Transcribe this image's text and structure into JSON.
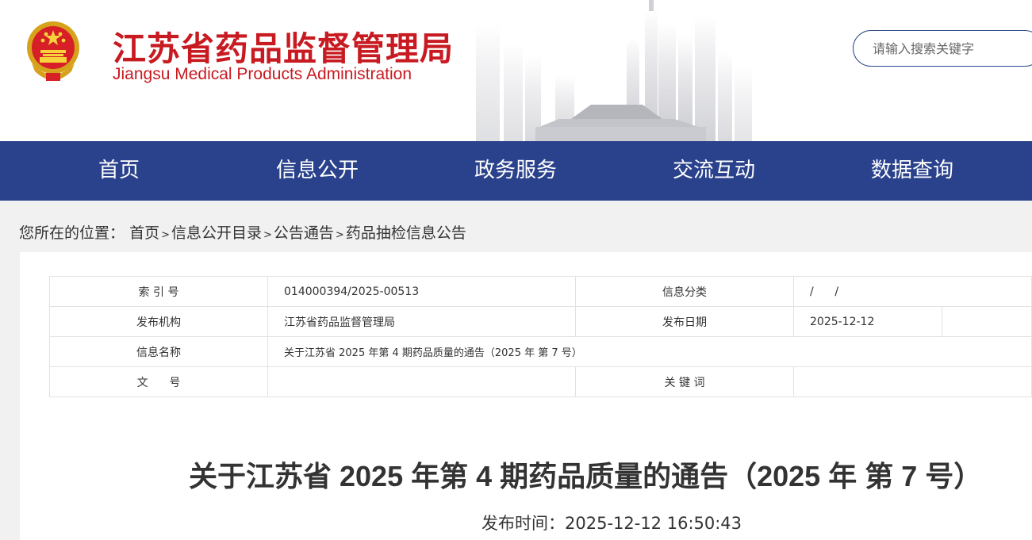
{
  "header": {
    "title_cn": "江苏省药品监督管理局",
    "title_en": "Jiangsu Medical Products Administration",
    "emblem_icon": "national-emblem-icon",
    "search_placeholder": "请输入搜索关键字"
  },
  "nav": {
    "items": [
      {
        "label": "首页"
      },
      {
        "label": "信息公开"
      },
      {
        "label": "政务服务"
      },
      {
        "label": "交流互动"
      },
      {
        "label": "数据查询"
      }
    ]
  },
  "breadcrumb": {
    "prefix": "您所在的位置：",
    "items": [
      {
        "label": "首页"
      },
      {
        "label": "信息公开目录"
      },
      {
        "label": "公告通告"
      },
      {
        "label": "药品抽检信息公告"
      }
    ],
    "separator": ">"
  },
  "meta": {
    "index_label": "索 引 号",
    "index_value": "014000394/2025-00513",
    "category_label": "信息分类",
    "category_value": "/      /",
    "publisher_label": "发布机构",
    "publisher_value": "江苏省药品监督管理局",
    "date_label": "发布日期",
    "date_value": "2025-12-12",
    "name_label": "信息名称",
    "name_value": "关于江苏省 2025 年第 4 期药品质量的通告（2025 年 第 7 号）",
    "docno_label": "文      号",
    "docno_value": "",
    "keywords_label": "关 键 词",
    "keywords_value": ""
  },
  "article": {
    "title": "关于江苏省 2025 年第 4 期药品质量的通告（2025 年 第 7 号）",
    "pubtime_label": "发布时间：",
    "pubtime_value": "2025-12-12 16:50:43"
  },
  "colors": {
    "brand_red": "#c81a21",
    "nav_blue": "#2a428c",
    "page_bg": "#f1f1f1"
  }
}
